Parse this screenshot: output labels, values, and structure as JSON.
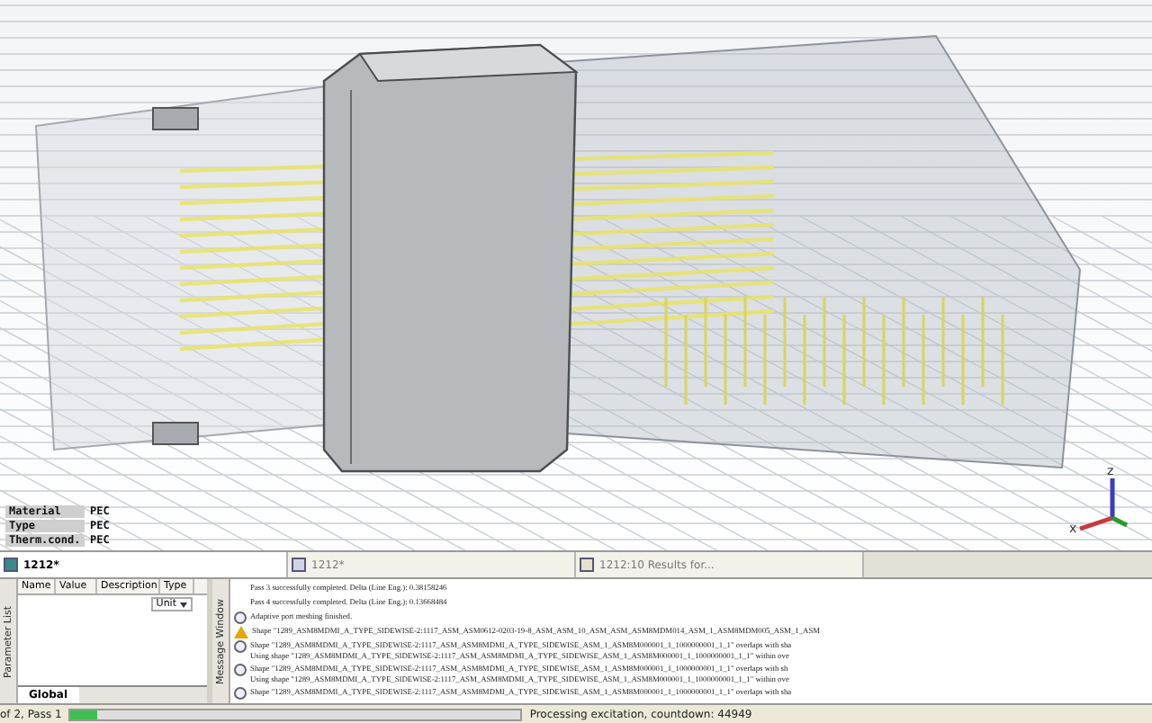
{
  "viewport": {
    "legend": [
      {
        "label": "Material",
        "value": "PEC"
      },
      {
        "label": "Type",
        "value": "PEC"
      },
      {
        "label": "Therm.cond.",
        "value": "PEC"
      }
    ],
    "axis_labels": [
      "z",
      "x"
    ]
  },
  "document_tabs": [
    {
      "label": "1212*",
      "kind": "model",
      "selected": true
    },
    {
      "label": "1212*",
      "kind": "schematic",
      "selected": false
    },
    {
      "label": "1212:10 Results for...",
      "kind": "results",
      "selected": false
    }
  ],
  "parameter_list": {
    "title": "Parameter List",
    "columns": [
      "Name",
      "Value",
      "Description",
      "Type"
    ],
    "type_unit": "Unit",
    "tabs": [
      {
        "label": "Global",
        "selected": true
      }
    ]
  },
  "message_window": {
    "title": "Message Window",
    "messages": [
      {
        "kind": "plain",
        "lines": [
          "Pass 3 successfully completed. Delta (Line Eng.): 0.38158246"
        ]
      },
      {
        "kind": "plain",
        "lines": [
          "Pass 4 successfully completed. Delta (Line Eng.): 0.13668484"
        ]
      },
      {
        "kind": "info",
        "lines": [
          "Adaptive port meshing finished."
        ]
      },
      {
        "kind": "warning",
        "lines": [
          "Shape \"1289_ASM8MDMI_A_TYPE_SIDEWISE-2:1117_ASM_ASM0612-0203-19-8_ASM_ASM_10_ASM_ASM_ASM8MDM014_ASM_1_ASM8MDM005_ASM_1_ASM"
        ]
      },
      {
        "kind": "info",
        "lines": [
          "Shape \"1289_ASM8MDMI_A_TYPE_SIDEWISE-2:1117_ASM_ASM8MDMI_A_TYPE_SIDEWISE_ASM_1_ASM8M000001_1_1000000001_1_1\" overlaps with sha",
          "Using shape \"1289_ASM8MDMI_A_TYPE_SIDEWISE-2:1117_ASM_ASM8MDMI_A_TYPE_SIDEWISE_ASM_1_ASM8M000001_1_1000000001_1_1\" within ove"
        ]
      },
      {
        "kind": "info",
        "lines": [
          "Shape \"1289_ASM8MDMI_A_TYPE_SIDEWISE-2:1117_ASM_ASM8MDMI_A_TYPE_SIDEWISE_ASM_1_ASM8M000001_1_1000000001_1_1\" overlaps with sh",
          "Using shape \"1289_ASM8MDMI_A_TYPE_SIDEWISE-2:1117_ASM_ASM8MDMI_A_TYPE_SIDEWISE_ASM_1_ASM8M000001_1_1000000001_1_1\" within ove"
        ]
      },
      {
        "kind": "info",
        "lines": [
          "Shape \"1289_ASM8MDMI_A_TYPE_SIDEWISE-2:1117_ASM_ASM8MDMI_A_TYPE_SIDEWISE_ASM_1_ASM8M000001_1_1000000001_1_1\" overlaps with sha"
        ]
      }
    ]
  },
  "status_bar": {
    "pass_text": "of 2, Pass 1",
    "progress": {
      "level": 0.06
    },
    "message": "Processing excitation, countdown: 44949"
  }
}
